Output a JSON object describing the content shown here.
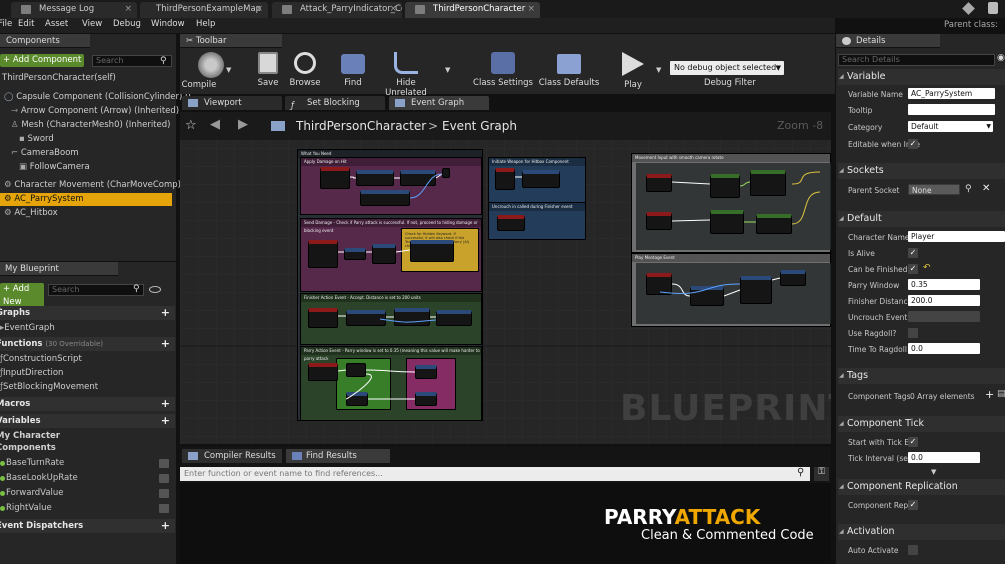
{
  "tabs": [
    {
      "label": "Message Log"
    },
    {
      "label": "ThirdPersonExampleMap"
    },
    {
      "label": "Attack_ParryIndicator_Co"
    },
    {
      "label": "ThirdPersonCharacter"
    }
  ],
  "parent_class_label": "Parent class:",
  "menu": [
    "File",
    "Edit",
    "Asset",
    "View",
    "Debug",
    "Window",
    "Help"
  ],
  "components": {
    "header": "Components",
    "add_label": "+ Add Component",
    "search_placeholder": "Search",
    "items": [
      "ThirdPersonCharacter(self)",
      "Capsule Component (CollisionCylinder) (I",
      "Arrow Component (Arrow) (Inherited)",
      "Mesh (CharacterMesh0) (Inherited)",
      "Sword",
      "CameraBoom",
      "FollowCamera",
      "Character Movement (CharMoveComp) (In",
      "AC_ParrySystem",
      "AC_Hitbox"
    ]
  },
  "my_blueprint": {
    "header": "My Blueprint",
    "add_label": "+ Add New",
    "search_placeholder": "Search",
    "graphs_label": "Graphs",
    "event_graph": "EventGraph",
    "functions_label": "Functions",
    "functions_note": "(30 Overridable)",
    "functions": [
      "ConstructionScript",
      "InputDirection",
      "SetBlockingMovement"
    ],
    "macros_label": "Macros",
    "variables_label": "Variables",
    "var_group_1": "My Character",
    "var_group_2": "Components",
    "variables": [
      "BaseTurnRate",
      "BaseLookUpRate",
      "ForwardValue",
      "RightValue"
    ],
    "dispatchers_label": "Event Dispatchers"
  },
  "toolbar": {
    "header": "Toolbar",
    "compile": "Compile",
    "save": "Save",
    "browse": "Browse",
    "find": "Find",
    "hide_unrelated": "Hide Unrelated",
    "class_settings": "Class Settings",
    "class_defaults": "Class Defaults",
    "play": "Play",
    "debug_select": "No debug object selected",
    "debug_filter": "Debug Filter"
  },
  "graph_tabs": [
    "Viewport",
    "Set Blocking Move",
    "Event Graph"
  ],
  "graph": {
    "crumb_root": "ThirdPersonCharacter",
    "crumb_sep": ">",
    "crumb_leaf": "Event Graph",
    "zoom": "Zoom -8",
    "watermark": "BLUEPRINT",
    "comments": [
      "What You Need",
      "Apply Damage on Hit",
      "Initiate Weapon for Hitbox Component",
      "Uncrouch in called during Finisher event",
      "Send Damage - Check if Parry attack is successful. If not, proceed to hiding damage or blocking event",
      "Finisher Action Event - Accept. Distance is set to 200 units",
      "Parry Action Event - Parry window is set to 0.35 (meaning this value will make harder to parry attack",
      "Movement Input with smooth camera rotate",
      "Play Montage Event"
    ],
    "note_text": "Check for Hidden Keyword. If successful, it will also check if the Target Attack is Hit Type of Parry (AI) check Impact Blocking"
  },
  "bottom": {
    "compiler_results": "Compiler Results",
    "find_results": "Find Results",
    "find_placeholder": "Enter function or event name to find references..."
  },
  "overlay": {
    "title_a": "PARRY",
    "title_b": "ATTACK",
    "subtitle": "Clean & Commented Code"
  },
  "details": {
    "header": "Details",
    "search_placeholder": "Search Details",
    "variable_section": "Variable",
    "variable_name_label": "Variable Name",
    "variable_name": "AC_ParrySystem",
    "tooltip_label": "Tooltip",
    "tooltip": "",
    "category_label": "Category",
    "category": "Default",
    "editable_label": "Editable when Inhe",
    "sockets_section": "Sockets",
    "parent_socket_label": "Parent Socket",
    "parent_socket": "None",
    "default_section": "Default",
    "character_name_label": "Character Name",
    "character_name": "Player",
    "is_alive_label": "Is Alive",
    "can_be_finished_label": "Can be Finished",
    "parry_window_label": "Parry Window",
    "parry_window": "0.35",
    "finisher_distance_label": "Finisher Distance",
    "finisher_distance": "200.0",
    "uncrouch_event_label": "Uncrouch Event",
    "use_ragdoll_label": "Use Ragdoll?",
    "time_to_ragdoll_label": "Time To Ragdoll",
    "time_to_ragdoll": "0.0",
    "tags_section": "Tags",
    "component_tags_label": "Component Tags",
    "component_tags": "0 Array elements",
    "tick_section": "Component Tick",
    "start_tick_label": "Start with Tick Enu",
    "tick_interval_label": "Tick Interval (secs",
    "tick_interval": "0.0",
    "replication_section": "Component Replication",
    "component_replic_label": "Component Replic",
    "activation_section": "Activation",
    "auto_activate_label": "Auto Activate"
  },
  "colors": {
    "selection": "#e5a50a",
    "add_green": "#5a8a2c",
    "accent_orange": "#f0a800"
  }
}
